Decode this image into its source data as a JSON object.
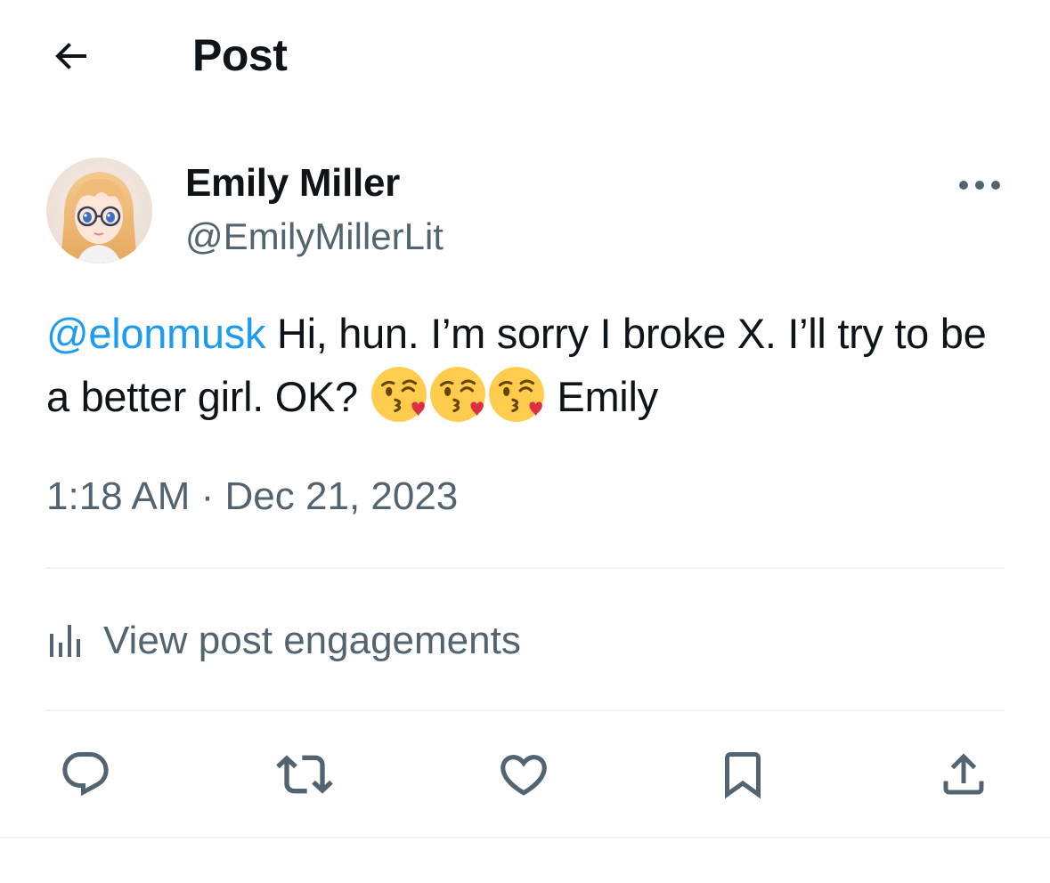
{
  "header": {
    "title": "Post",
    "back_icon": "arrow-left-icon"
  },
  "author": {
    "name": "Emily Miller",
    "handle": "@EmilyMillerLit",
    "avatar_icon": "avatar-anime-girl"
  },
  "post": {
    "mention": "@elonmusk",
    "text_before_emoji": " Hi, hun. I’m sorry I broke X. I’ll try to be a better girl. OK? ",
    "emoji": [
      "face-blowing-kiss-emoji",
      "face-blowing-kiss-emoji",
      "face-blowing-kiss-emoji"
    ],
    "text_after_emoji": " Emily",
    "timestamp": "1:18 AM · Dec 21, 2023"
  },
  "engagements": {
    "label": "View post engagements",
    "icon": "analytics-bars-icon"
  },
  "actions": [
    "reply-icon",
    "repost-icon",
    "like-icon",
    "bookmark-icon",
    "share-icon"
  ],
  "colors": {
    "text": "#0f1419",
    "secondary": "#536471",
    "link": "#1d9bf0",
    "divider": "#eff3f4"
  }
}
